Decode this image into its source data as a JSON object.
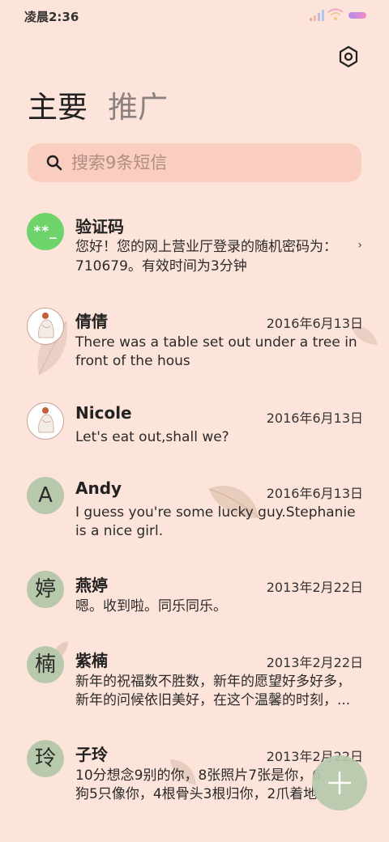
{
  "status_bar": {
    "time": "凌晨2:36"
  },
  "tabs": [
    {
      "label": "主要"
    },
    {
      "label": "推广"
    }
  ],
  "search": {
    "placeholder": "搜索9条短信"
  },
  "conversations": [
    {
      "name": "验证码",
      "avatar": "**_",
      "date": "",
      "lines": [
        "您好！您的网上营业厅登录的随机密码为：",
        "710679。有效时间为3分钟"
      ]
    },
    {
      "name": "倩倩",
      "avatar": "",
      "date": "2016年6月13日",
      "lines": [
        "There was a table set out under a tree in",
        "front of the hous"
      ]
    },
    {
      "name": "Nicole",
      "avatar": "",
      "date": "2016年6月13日",
      "lines": [
        "Let's eat out,shall we?"
      ]
    },
    {
      "name": "Andy",
      "avatar": "A",
      "date": "2016年6月13日",
      "lines": [
        "I guess you're some lucky guy.Stephanie",
        "is a nice girl."
      ]
    },
    {
      "name": "燕婷",
      "avatar": "婷",
      "date": "2013年2月22日",
      "lines": [
        "嗯。收到啦。同乐同乐。"
      ]
    },
    {
      "name": "紫楠",
      "avatar": "楠",
      "date": "2013年2月22日",
      "lines": [
        "新年的祝福数不胜数，新年的愿望好多好多，",
        "新年的问候依旧美好，在这个温馨的时刻，..."
      ]
    },
    {
      "name": "子玲",
      "avatar": "玲",
      "date": "2013年2月22日",
      "lines": [
        "10分想念9别的你，8张照片7张是你，6",
        "狗5只像你，4根骨头3根归你，2爪着地"
      ]
    }
  ],
  "colors": {
    "background": "#fde4da",
    "search_bg": "#f9cdbf",
    "letter_avatar": "#b8c9ab",
    "code_avatar": "#6ed36a",
    "fab": "#b7c8ad"
  },
  "icons": {
    "settings": "settings-hexagon-icon",
    "search": "search-icon",
    "fab": "plus-icon",
    "chevron": "chevron-right-icon"
  }
}
